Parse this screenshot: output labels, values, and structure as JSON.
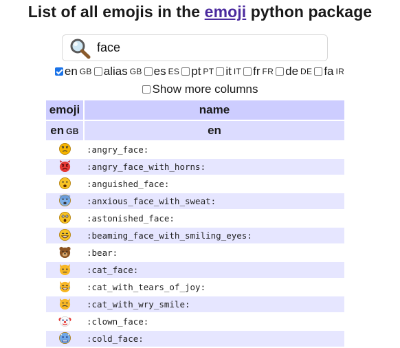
{
  "header": {
    "title_before": "List of all emojis in the",
    "title_link": "emoji",
    "title_after": "python package"
  },
  "search": {
    "value": "face",
    "icon": "magnifier-icon"
  },
  "languages": [
    {
      "code": "en",
      "region": "GB",
      "checked": true
    },
    {
      "code": "alias",
      "region": "GB",
      "checked": false
    },
    {
      "code": "es",
      "region": "ES",
      "checked": false
    },
    {
      "code": "pt",
      "region": "PT",
      "checked": false
    },
    {
      "code": "it",
      "region": "IT",
      "checked": false
    },
    {
      "code": "fr",
      "region": "FR",
      "checked": false
    },
    {
      "code": "de",
      "region": "DE",
      "checked": false
    },
    {
      "code": "fa",
      "region": "IR",
      "checked": false
    }
  ],
  "more_columns": {
    "label": "Show more columns",
    "checked": false
  },
  "table": {
    "headers": [
      "emoji",
      "name"
    ],
    "subheaders": [
      "en",
      "GB",
      "en"
    ],
    "rows": [
      {
        "emoji": "angry",
        "name": ":angry_face:"
      },
      {
        "emoji": "horns",
        "name": ":angry_face_with_horns:"
      },
      {
        "emoji": "anguished",
        "name": ":anguished_face:"
      },
      {
        "emoji": "sweat",
        "name": ":anxious_face_with_sweat:"
      },
      {
        "emoji": "astonished",
        "name": ":astonished_face:"
      },
      {
        "emoji": "beaming",
        "name": ":beaming_face_with_smiling_eyes:"
      },
      {
        "emoji": "bear",
        "name": ":bear:"
      },
      {
        "emoji": "cat",
        "name": ":cat_face:"
      },
      {
        "emoji": "catjoy",
        "name": ":cat_with_tears_of_joy:"
      },
      {
        "emoji": "catwry",
        "name": ":cat_with_wry_smile:"
      },
      {
        "emoji": "clown",
        "name": ":clown_face:"
      },
      {
        "emoji": "cold",
        "name": ":cold_face:"
      }
    ]
  },
  "colors": {
    "header_bg": "#cdcdff",
    "row_alt": "#e6e6ff",
    "link": "#4b2a9e",
    "check": "#1a73e8"
  }
}
